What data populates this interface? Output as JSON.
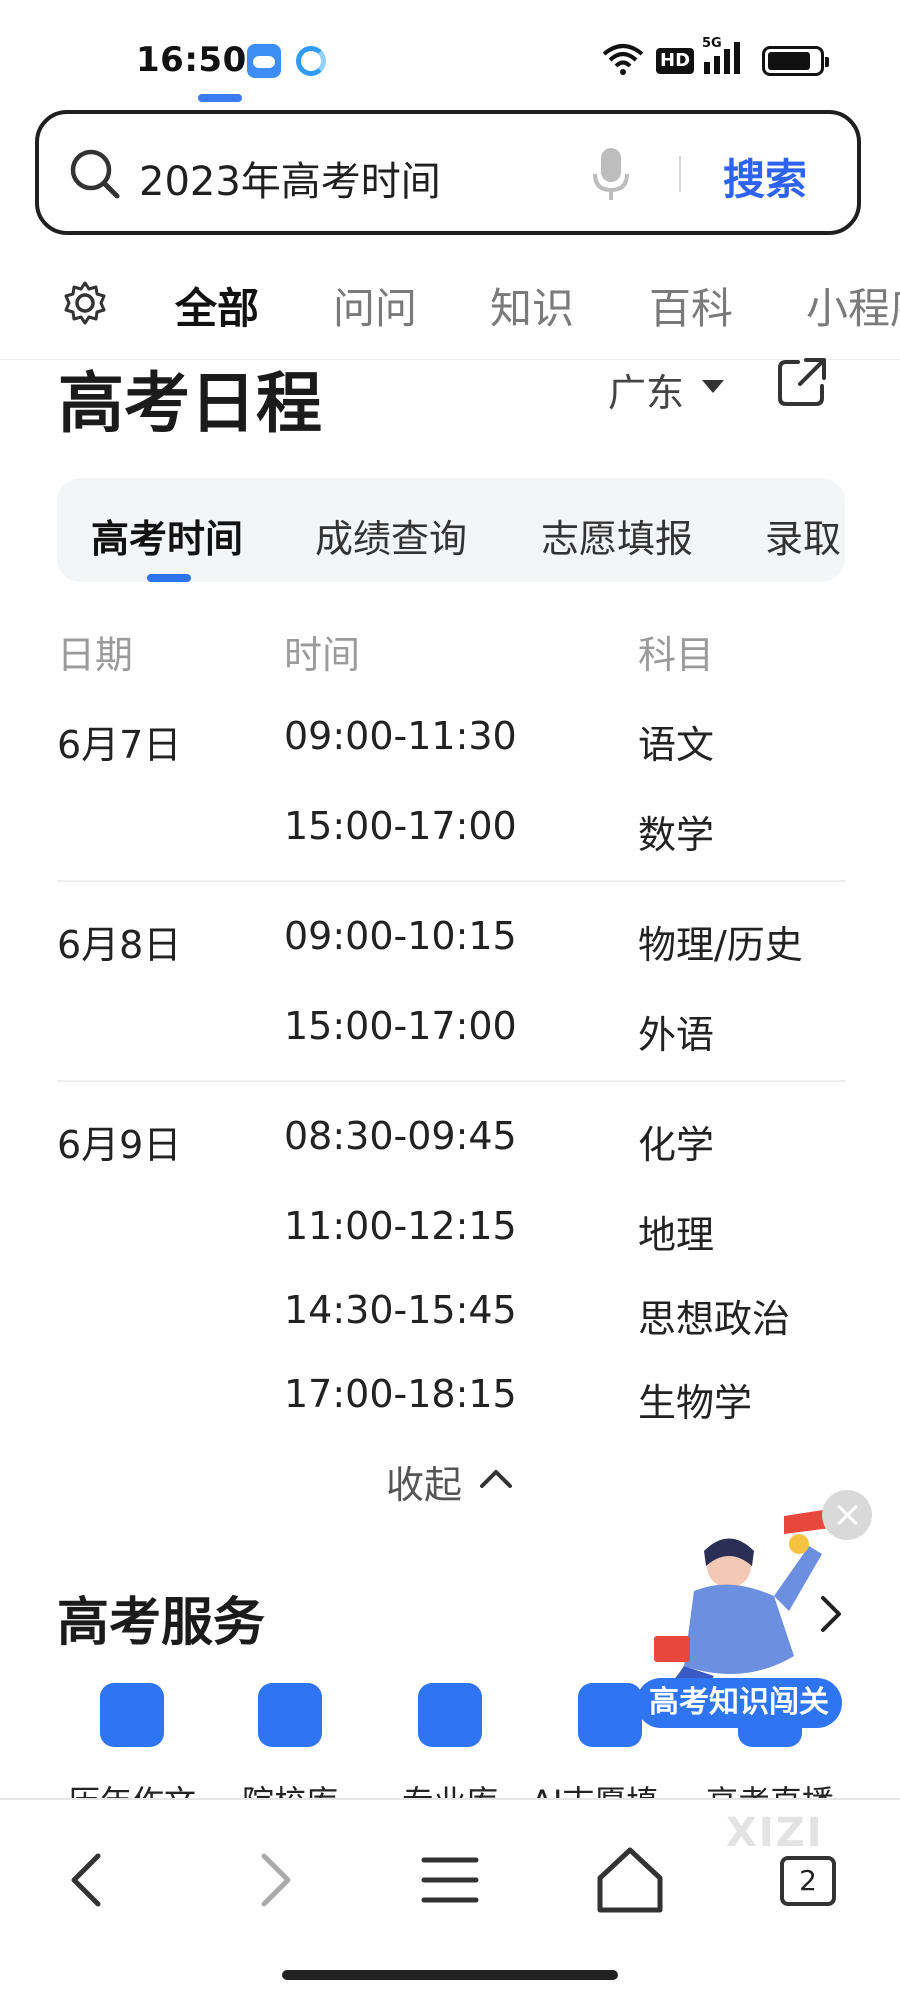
{
  "status_bar": {
    "time": "16:50",
    "network": "5G",
    "hd_badge": "HD"
  },
  "search": {
    "query": "2023年高考时间",
    "button_label": "搜索"
  },
  "category_tabs": [
    "全部",
    "问问",
    "知识",
    "百科",
    "小程序"
  ],
  "card": {
    "title": "高考日程",
    "region": "广东",
    "sub_tabs": [
      "高考时间",
      "成绩查询",
      "志愿填报",
      "录取"
    ],
    "columns": [
      "日期",
      "时间",
      "科目"
    ],
    "schedule": [
      {
        "date": "6月7日",
        "time": "09:00-11:30",
        "subject": "语文"
      },
      {
        "date": "",
        "time": "15:00-17:00",
        "subject": "数学"
      },
      {
        "date": "6月8日",
        "time": "09:00-10:15",
        "subject": "物理/历史"
      },
      {
        "date": "",
        "time": "15:00-17:00",
        "subject": "外语"
      },
      {
        "date": "6月9日",
        "time": "08:30-09:45",
        "subject": "化学"
      },
      {
        "date": "",
        "time": "11:00-12:15",
        "subject": "地理"
      },
      {
        "date": "",
        "time": "14:30-15:45",
        "subject": "思想政治"
      },
      {
        "date": "",
        "time": "17:00-18:15",
        "subject": "生物学"
      }
    ],
    "collapse_label": "收起"
  },
  "services": {
    "title": "高考服务",
    "items": [
      "历年作文",
      "院校库",
      "专业库",
      "AI志愿填...",
      "高考直播"
    ]
  },
  "promo": {
    "label": "高考知识闯关"
  },
  "bottom_nav": {
    "tabs_count": "2",
    "watermark": "XIZI"
  },
  "colors": {
    "accent": "#2f74f1",
    "search_button": "#2d63f0"
  }
}
